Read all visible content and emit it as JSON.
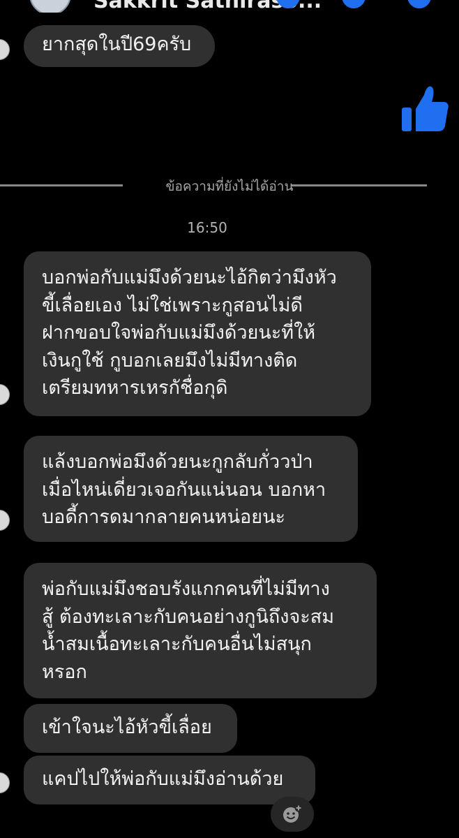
{
  "header": {
    "contact_name": "Sakkrit Sathiraso..."
  },
  "messages": [
    {
      "text": "ยากสุดในปี69ครับ"
    },
    {
      "text": "บอกพ่อกับแม่มึงด้วยนะไอ้กิตว่ามึงหัว\nขี้เลื่อยเอง ไม่ใช่เพราะกูสอนไม่ดี\nฝากขอบใจพ่อกับแม่มึงด้วยนะที่ให้\nเงินกูใช้ กูบอกเลยมึงไม่มีทางติด\nเตรียมทหารเหรกัชื่อกุดิ"
    },
    {
      "text": "แล้งบอกพ่อมึงด้วยนะกูกลับกั่ววป่า\nเมื่อไหน่เดี่ยวเจอกันแน่นอน บอกหา\nบอดี้การดมากลายคนหน่อยนะ"
    },
    {
      "text": "พ่อกับแม่มึงชอบรังแกกคนที่ไม่มีทาง\nสู้ ต้องทะเลาะกับคนอย่างกูนิถึงจะสม\nน้ำสมเนื้อทะเลาะกับคนอื่นไม่สนุก\nหรอก"
    },
    {
      "text": "เข้าใจนะไอ้หัวขี้เลื่อย"
    },
    {
      "text": "แคปไปให้พ่อกับแม่มึงอ่านด้วย"
    }
  ],
  "unread_divider": "ข้อความที่ยังไม่ได้อ่าน",
  "timestamp": "16:50",
  "colors": {
    "background": "#000000",
    "bubble": "#303030",
    "accent": "#1f6ff0"
  },
  "icons": {
    "like": "thumbs-up-icon",
    "react": "add-reaction-icon"
  }
}
